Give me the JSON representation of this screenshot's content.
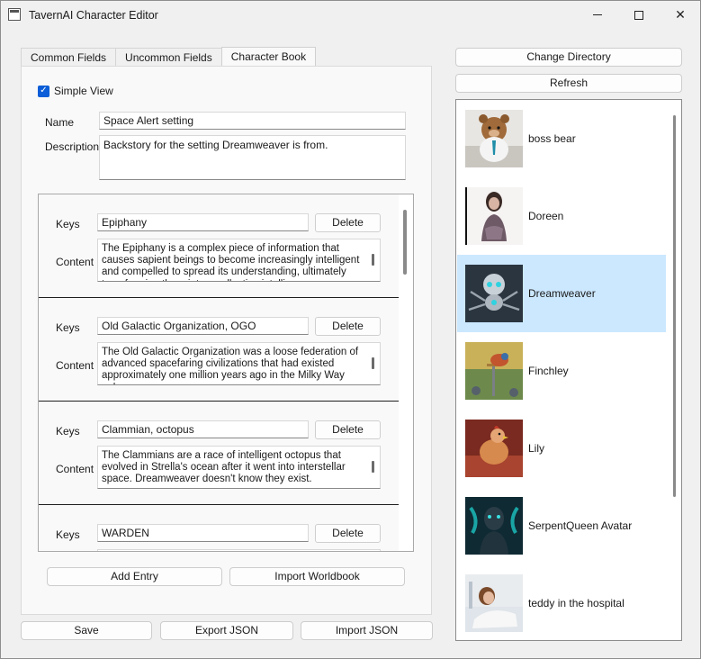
{
  "window": {
    "title": "TavernAI Character Editor",
    "close_glyph": "✕"
  },
  "tabs": [
    {
      "label": "Common Fields",
      "active": false
    },
    {
      "label": "Uncommon Fields",
      "active": false
    },
    {
      "label": "Character Book",
      "active": true
    }
  ],
  "simple_view": {
    "label": "Simple View",
    "checked": true,
    "check_glyph": "✓"
  },
  "book": {
    "name_label": "Name",
    "name_value": "Space Alert setting",
    "description_label": "Description",
    "description_value": "Backstory for the setting Dreamweaver is from."
  },
  "entry_labels": {
    "keys": "Keys",
    "content": "Content",
    "delete": "Delete"
  },
  "entries": [
    {
      "keys": "Epiphany",
      "content": "The Epiphany is a complex piece of information that causes sapient beings to become increasingly intelligent and compelled to spread its understanding, ultimately transforming them into a collective intelligence"
    },
    {
      "keys": "Old Galactic Organization, OGO",
      "content": "The Old Galactic Organization was a loose federation of advanced spacefaring civilizations that had existed approximately one million years ago in the Milky Way galaxy."
    },
    {
      "keys": "Clammian, octopus",
      "content": "The Clammians are a race of intelligent octopus that evolved in Strella's ocean after it went into interstellar space. Dreamweaver doesn't know they exist."
    },
    {
      "keys": "WARDEN",
      "content": ""
    }
  ],
  "buttons": {
    "add_entry": "Add Entry",
    "import_worldbook": "Import Worldbook",
    "save": "Save",
    "export_json": "Export JSON",
    "import_json": "Import JSON",
    "change_directory": "Change Directory",
    "refresh": "Refresh"
  },
  "characters": [
    {
      "name": "boss bear",
      "selected": false,
      "icon": "bear-avatar-icon"
    },
    {
      "name": "Doreen",
      "selected": false,
      "icon": "woman-avatar-icon"
    },
    {
      "name": "Dreamweaver",
      "selected": true,
      "icon": "robot-spider-avatar-icon"
    },
    {
      "name": "Finchley",
      "selected": false,
      "icon": "bird-sword-avatar-icon"
    },
    {
      "name": "Lily",
      "selected": false,
      "icon": "chicken-avatar-icon"
    },
    {
      "name": "SerpentQueen Avatar",
      "selected": false,
      "icon": "serpent-queen-avatar-icon"
    },
    {
      "name": "teddy in the hospital",
      "selected": false,
      "icon": "teddy-hospital-avatar-icon"
    }
  ],
  "colors": {
    "accent": "#0b5ed7",
    "selection": "#cce8ff",
    "entry_separator": "#1e1e1e"
  }
}
